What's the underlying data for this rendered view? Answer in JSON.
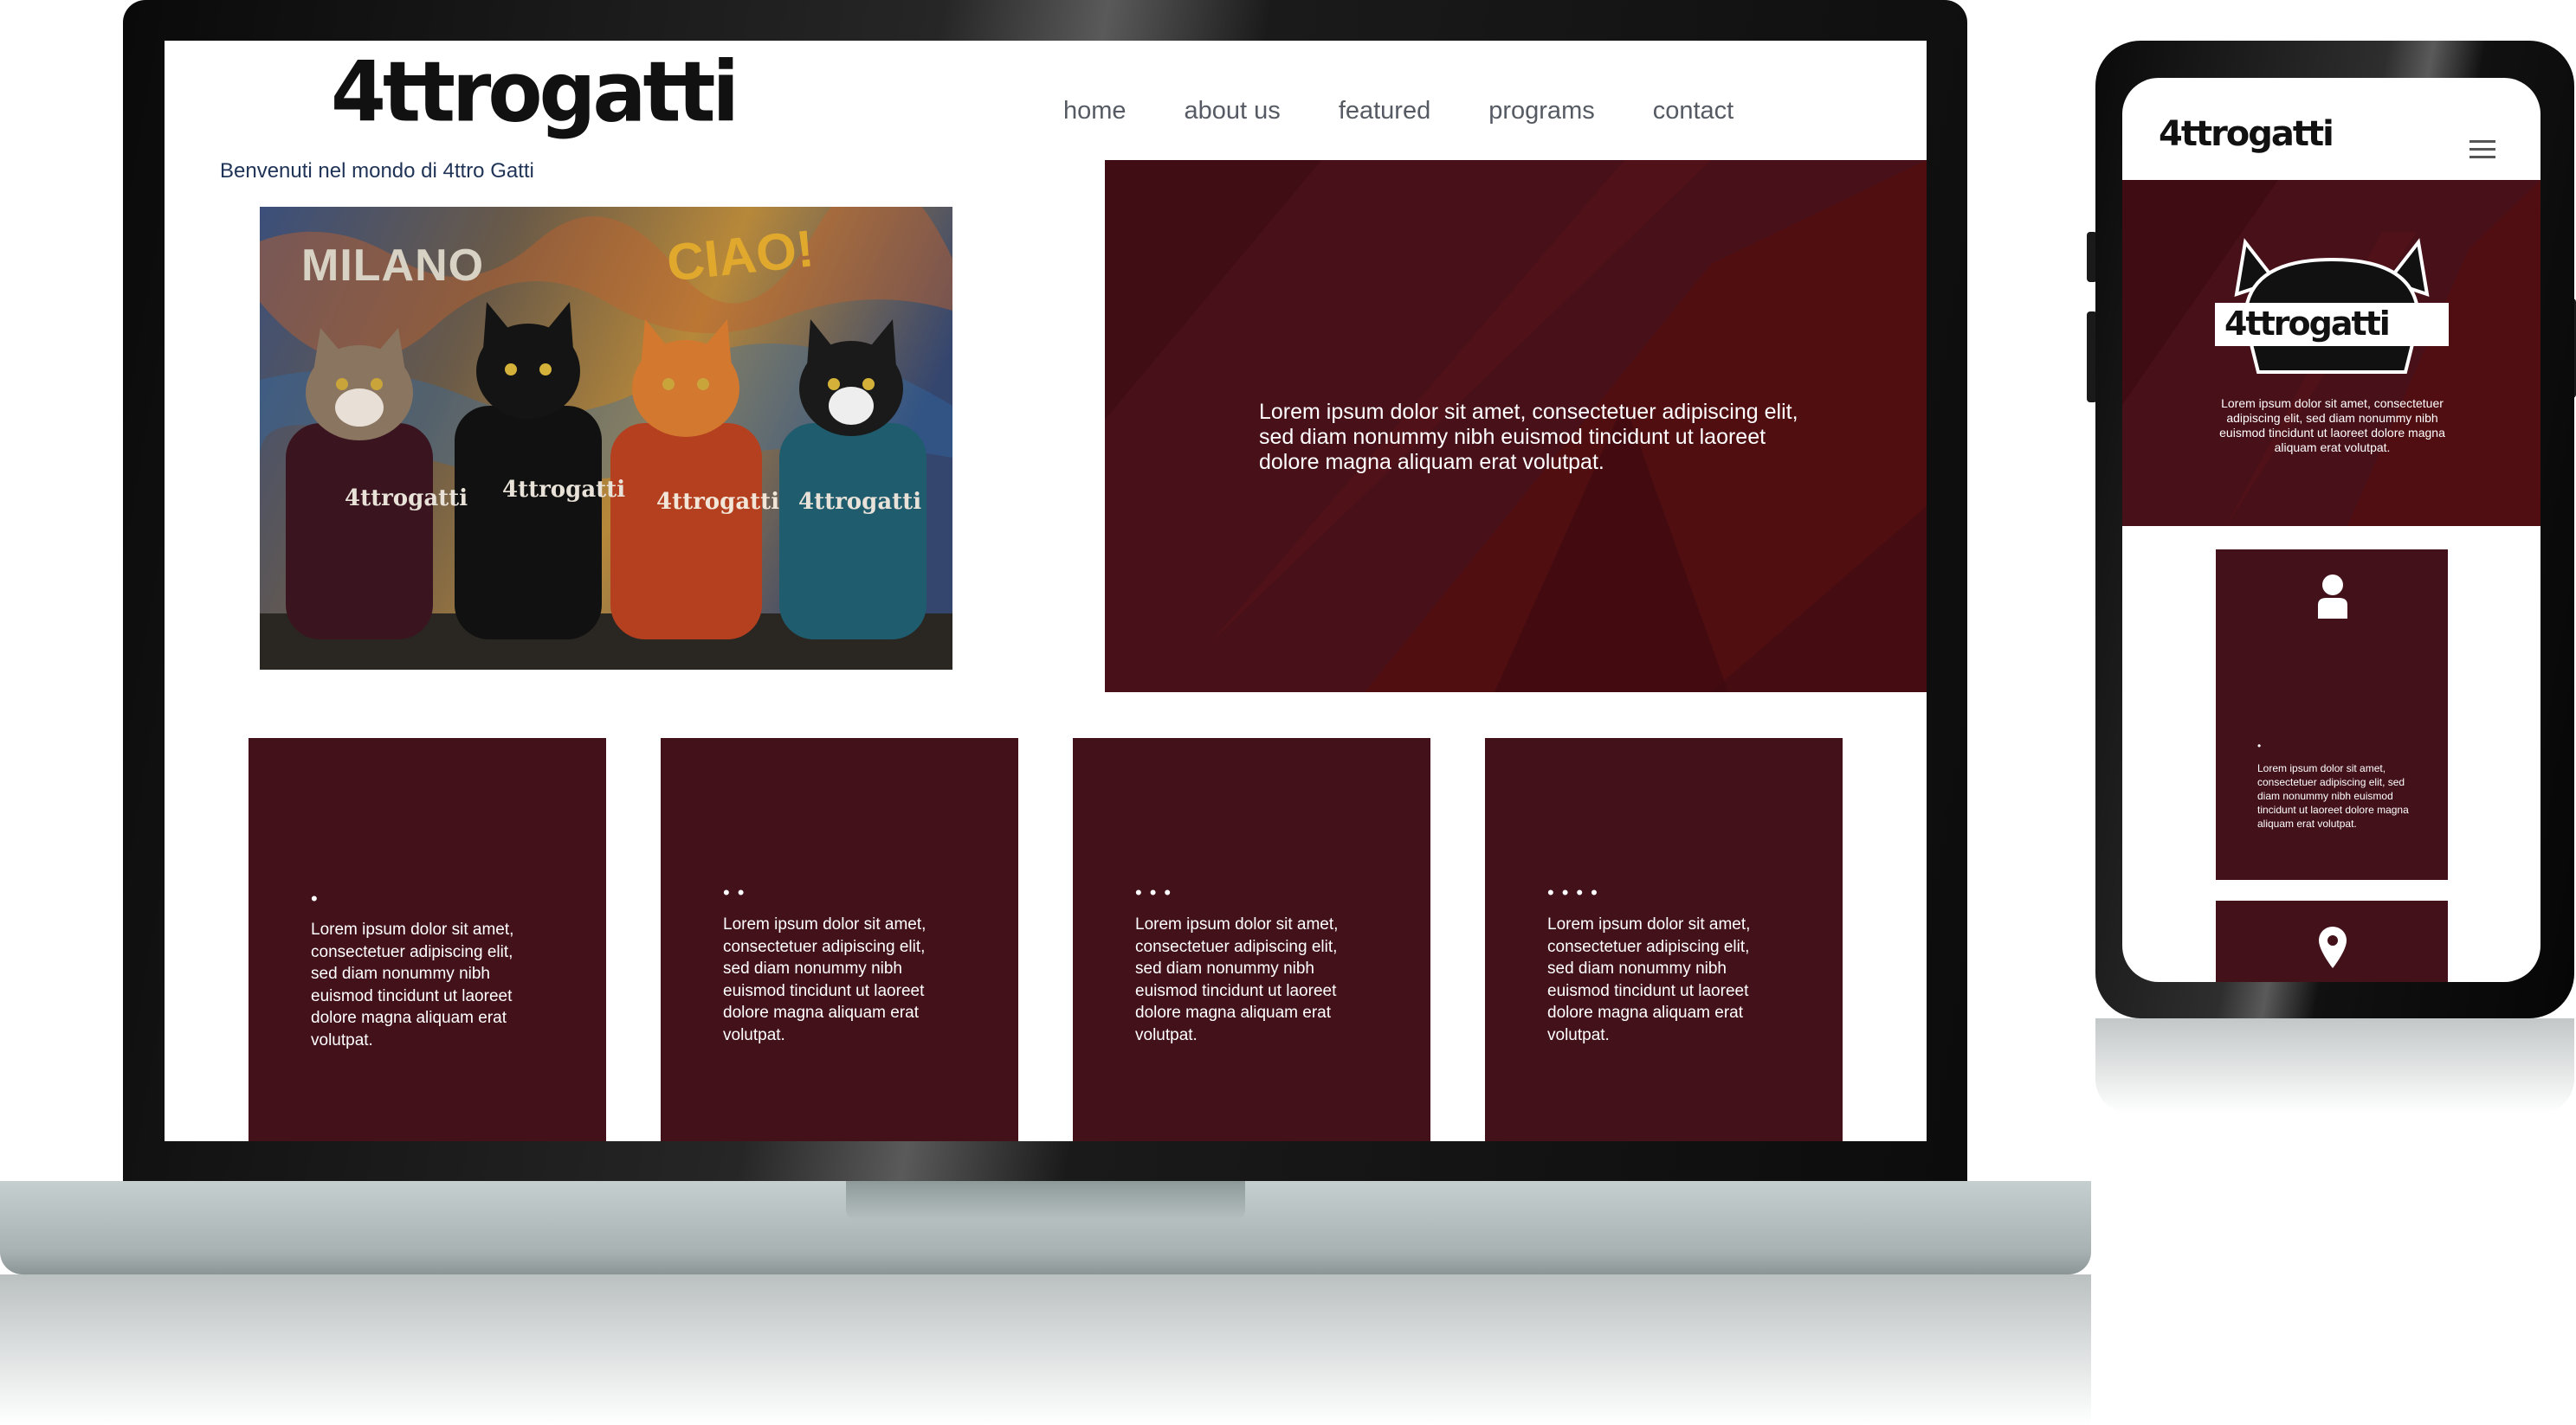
{
  "brand": {
    "logo_text": "4ttrogatti"
  },
  "nav": {
    "items": [
      "home",
      "about us",
      "featured",
      "programs",
      "contact"
    ]
  },
  "tagline": "Benvenuti nel mondo di 4ttro Gatti",
  "hero_image": {
    "wall_text_left": "MILANO",
    "wall_text_right": "CIAO!",
    "hoodie_labels": [
      "4ttrogatti",
      "4ttrogatti",
      "4ttrogatti",
      "4ttrogatti"
    ]
  },
  "hero_panel": {
    "text": "Lorem ipsum dolor sit amet, consectetuer adipiscing elit, sed diam nonummy nibh euismod tincidunt ut laoreet dolore magna aliquam erat volutpat."
  },
  "cards": [
    {
      "dots": "•",
      "text": "Lorem ipsum dolor sit amet, consectetuer adipiscing elit, sed diam nonummy nibh euismod tincidunt ut laoreet dolore magna aliquam erat volutpat."
    },
    {
      "dots": "••",
      "text": "Lorem ipsum dolor sit amet, consectetuer adipiscing elit, sed diam nonummy nibh euismod tincidunt ut laoreet dolore magna aliquam erat volutpat."
    },
    {
      "dots": "•••",
      "text": "Lorem ipsum dolor sit amet, consectetuer adipiscing elit, sed diam nonummy nibh euismod tincidunt ut laoreet dolore magna aliquam erat volutpat."
    },
    {
      "dots": "••••",
      "text": "Lorem ipsum dolor sit amet, consectetuer adipiscing elit, sed diam nonummy nibh euismod tincidunt ut laoreet dolore magna aliquam erat volutpat."
    }
  ],
  "mobile": {
    "logo_text": "4ttrogatti",
    "hero_logo_text": "4ttrogatti",
    "hero_text": "Lorem ipsum dolor sit amet, consectetuer adipiscing elit, sed diam nonummy nibh euismod tincidunt ut laoreet dolore magna aliquam erat volutpat.",
    "card1": {
      "icon": "user-icon",
      "dots": "•",
      "text": "Lorem ipsum dolor sit amet, consectetuer adipiscing elit, sed diam nonummy nibh euismod tincidunt ut laoreet dolore magna aliquam erat volutpat."
    },
    "card2": {
      "icon": "map-pin-icon"
    }
  },
  "colors": {
    "brand_maroon": "#481018",
    "card_maroon": "#42111a",
    "nav_text": "#555a63",
    "tagline": "#1f3357"
  }
}
